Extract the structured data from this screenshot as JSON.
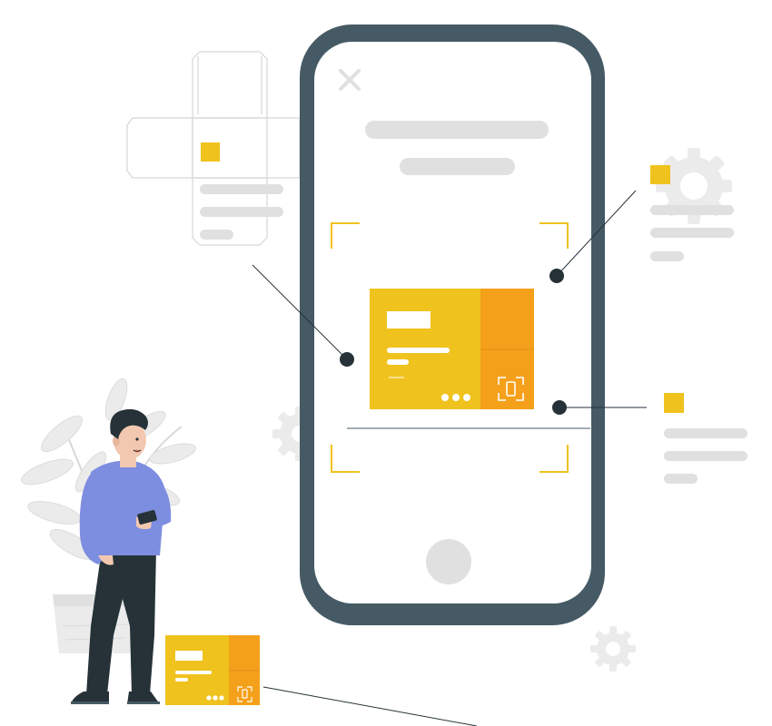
{
  "colors": {
    "phone_frame": "#455a64",
    "phone_screen": "#ffffff",
    "placeholder_bar": "#e0e0e0",
    "accent_yellow": "#f0c21d",
    "accent_orange": "#f5a01a",
    "shirt": "#7d8ee0",
    "trousers": "#263238",
    "skin": "#f2c8b0",
    "decor_gray": "#ebebeb",
    "line_dark": "#263238"
  },
  "icons": [
    "close-icon",
    "gear-icon",
    "scan-icon",
    "more-dots-icon",
    "home-button-icon",
    "smartphone-icon"
  ]
}
